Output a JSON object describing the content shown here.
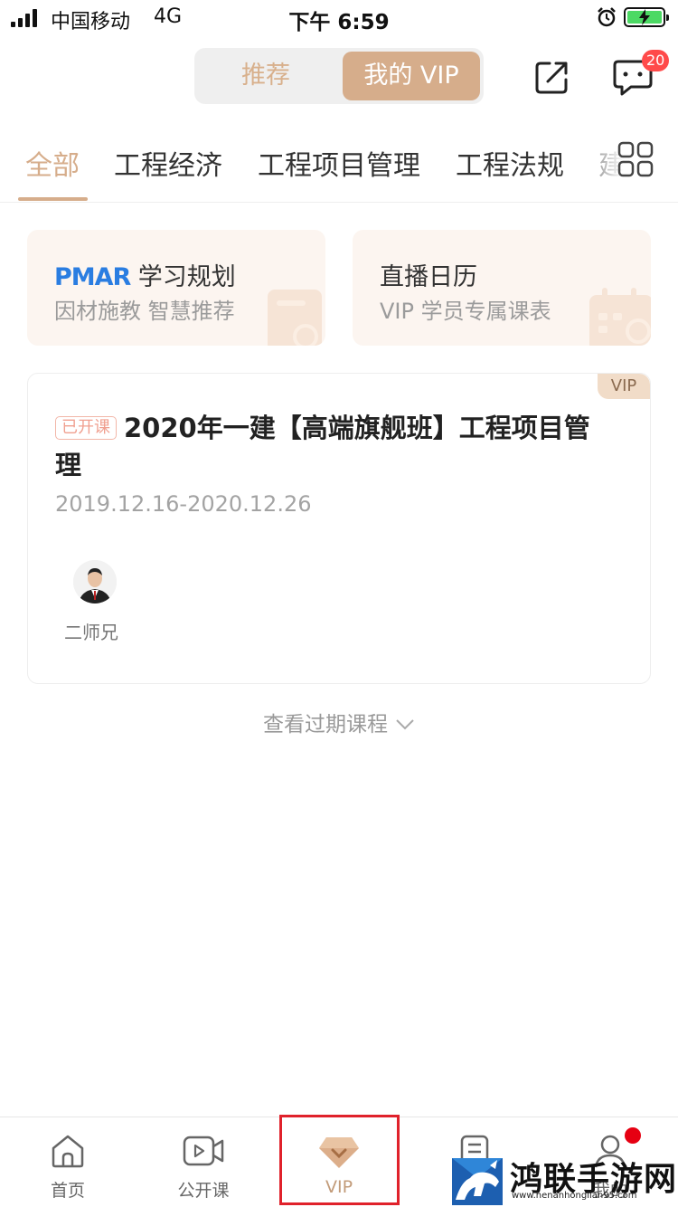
{
  "status_bar": {
    "carrier": "中国移动",
    "network": "4G",
    "time": "下午 6:59"
  },
  "header": {
    "segments": [
      "推荐",
      "我的 VIP"
    ],
    "active_segment": "我的 VIP",
    "message_badge": "20"
  },
  "tabs": {
    "items": [
      "全部",
      "工程经济",
      "工程项目管理",
      "工程法规",
      "建"
    ],
    "active": "全部"
  },
  "feature_cards": [
    {
      "title_logo": "PMAR",
      "title": "学习规划",
      "subtitle": "因材施教 智慧推荐"
    },
    {
      "title": "直播日历",
      "subtitle": "VIP 学员专属课表"
    }
  ],
  "course": {
    "tag": "VIP",
    "status_badge": "已开课",
    "title": "2020年一建【高端旗舰班】工程项目管理",
    "date_range": "2019.12.16-2020.12.26",
    "teacher": "二师兄"
  },
  "expired_link": "查看过期课程",
  "bottom_nav": {
    "items": [
      "首页",
      "公开课",
      "VIP",
      "题库",
      "我的"
    ],
    "active": "VIP"
  },
  "watermark": {
    "text": "鸿联手游网",
    "url": "www.henanhonglian95.com"
  },
  "colors": {
    "accent": "#d6ad8b",
    "badge_red": "#ff4a4a",
    "highlight_red": "#e0212b"
  }
}
